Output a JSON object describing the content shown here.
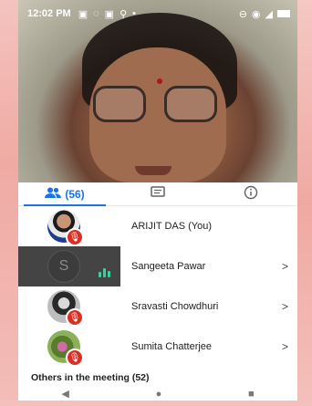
{
  "status_bar": {
    "time": "12:02 PM",
    "left_icons": [
      "notification-icon",
      "whatsapp-icon",
      "notification-icon",
      "location-icon"
    ],
    "right_icons": [
      "do-not-disturb-icon",
      "wifi-icon",
      "signal-icon",
      "battery-icon"
    ]
  },
  "tabs": [
    {
      "label": "(56)",
      "icon": "people-icon",
      "active": true
    },
    {
      "label": "",
      "icon": "chat-icon",
      "active": false
    },
    {
      "label": "",
      "icon": "info-icon",
      "active": false
    }
  ],
  "participants": [
    {
      "name": "ARIJIT DAS (You)",
      "avatar": "photo",
      "muted": true,
      "speaking": false,
      "chevron": ""
    },
    {
      "name": "Sangeeta Pawar",
      "avatar_letter": "S",
      "muted": false,
      "speaking": true,
      "chevron": ">"
    },
    {
      "name": "Sravasti Chowdhuri",
      "avatar": "photo",
      "muted": true,
      "speaking": false,
      "chevron": ">"
    },
    {
      "name": "Sumita Chatterjee",
      "avatar": "photo",
      "muted": true,
      "speaking": false,
      "chevron": ">"
    }
  ],
  "others_label": "Others in the meeting (52)",
  "nav": {
    "back": "◀",
    "home": "●",
    "recents": "■"
  },
  "colors": {
    "accent": "#1a73e8",
    "mute": "#d93025",
    "speaking": "#34d399"
  }
}
